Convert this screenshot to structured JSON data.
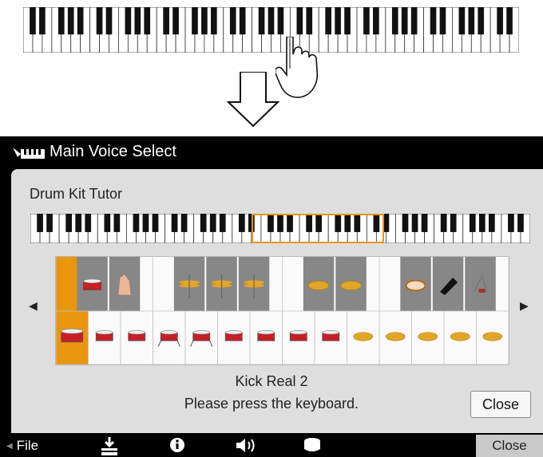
{
  "window": {
    "title": "Main Voice Select",
    "title_icon": "keyboard-voice-icon"
  },
  "panel": {
    "title": "Drum Kit Tutor"
  },
  "voice": {
    "name": "Kick Real 2"
  },
  "prompt": "Please press the keyboard.",
  "buttons": {
    "close": "Close"
  },
  "bottom_bar": {
    "file_label": "File",
    "file_icon": "left-arrow-icon",
    "icons": [
      "load-icon",
      "info-icon",
      "speaker-icon",
      "drum-icon"
    ],
    "close_label": "Close"
  },
  "nav": {
    "left": "◀",
    "right": "▶"
  },
  "colors": {
    "accent": "#e8960e",
    "screen_bg": "#000000",
    "panel_bg": "#dedede",
    "drum_red": "#c81e28",
    "cymbal_gold": "#e3a527"
  },
  "grid": {
    "upper_row_items": [
      "snare-drum-icon",
      "hand-clap-icon",
      "hi-hat-icon",
      "hi-hat-icon",
      "hi-hat-icon",
      "cymbal-icon",
      "cymbal-icon",
      "tambourine-icon",
      "cowbell-icon",
      "triangle-icon"
    ],
    "lower_row_items": [
      "kick-drum-icon",
      "snare-drum-icon",
      "snare-drum-icon",
      "floor-tom-icon",
      "floor-tom-icon",
      "tom-icon",
      "tom-icon",
      "tom-icon",
      "tom-icon",
      "cymbal-icon",
      "cymbal-icon",
      "cymbal-icon",
      "cymbal-icon",
      "cymbal-icon"
    ],
    "selected_lower_index": 0
  }
}
